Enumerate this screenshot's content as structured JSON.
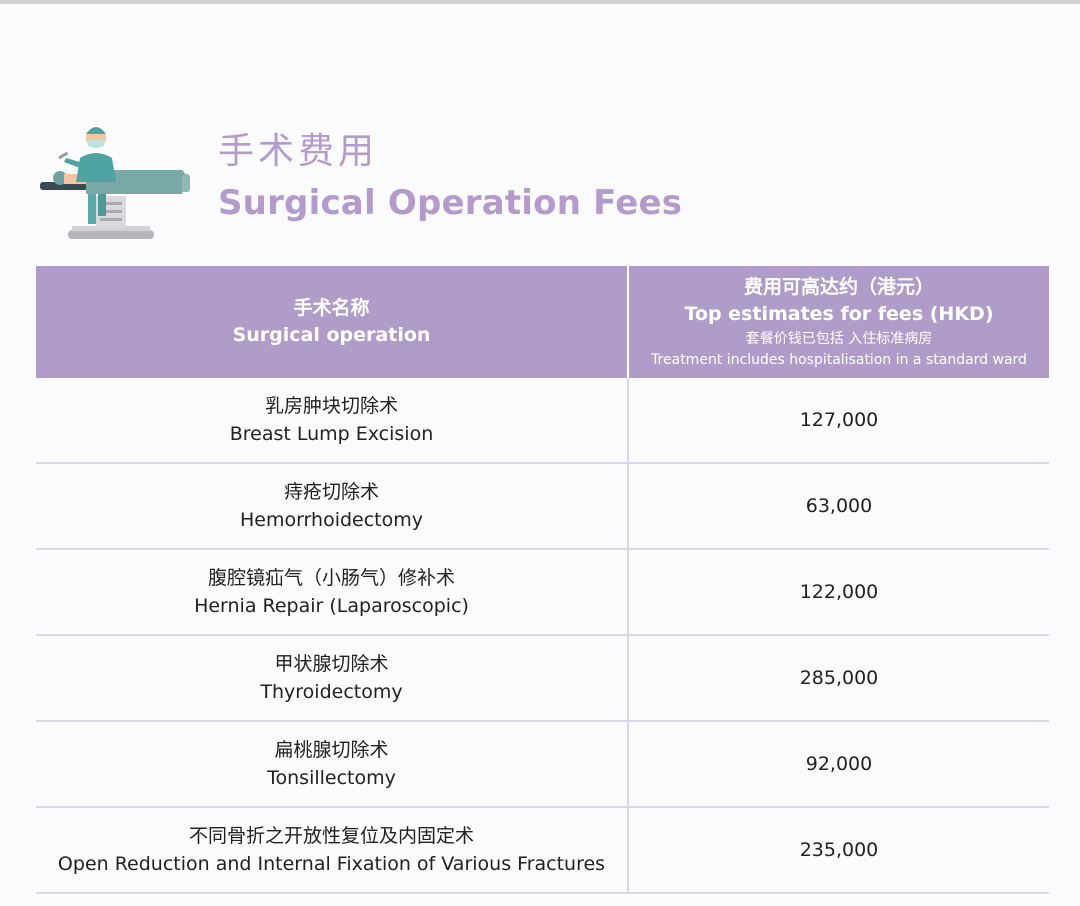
{
  "heading": {
    "title_zh": "手术费用",
    "title_en": "Surgical Operation Fees",
    "illustration": "surgeon-operating-table-illustration"
  },
  "table": {
    "header": {
      "col1_zh": "手术名称",
      "col1_en": "Surgical operation",
      "col2_zh": "费用可高达约（港元）",
      "col2_en": "Top estimates for fees (HKD)",
      "col2_note_zh": "套餐价钱已包括 入住标准病房",
      "col2_note_en": "Treatment includes hospitalisation in a standard ward"
    },
    "rows": [
      {
        "zh": "乳房肿块切除术",
        "en": "Breast Lump Excision",
        "fee": "127,000"
      },
      {
        "zh": "痔疮切除术",
        "en": "Hemorrhoidectomy",
        "fee": "63,000"
      },
      {
        "zh": "腹腔镜疝气（小肠气）修补术",
        "en": "Hernia Repair (Laparoscopic)",
        "fee": "122,000"
      },
      {
        "zh": "甲状腺切除术",
        "en": "Thyroidectomy",
        "fee": "285,000"
      },
      {
        "zh": "扁桃腺切除术",
        "en": "Tonsillectomy",
        "fee": "92,000"
      },
      {
        "zh": "不同骨折之开放性复位及内固定术",
        "en": "Open Reduction and Internal Fixation of Various Fractures",
        "fee": "235,000"
      }
    ]
  },
  "colors": {
    "accent": "#b49bcb",
    "header_bg": "#b09cc9",
    "divider": "#dcd6e7"
  }
}
